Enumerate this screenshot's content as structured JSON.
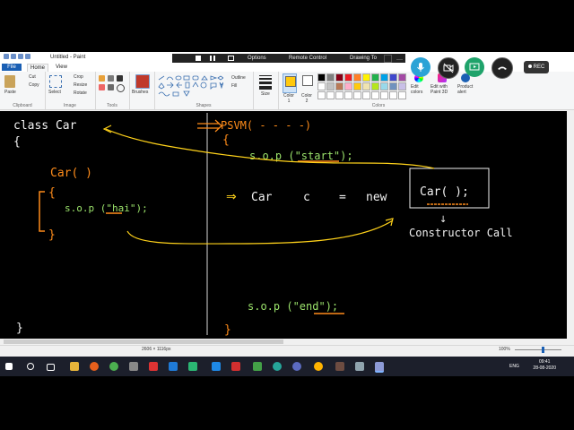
{
  "window": {
    "title": "Untitled - Paint"
  },
  "remote_bar": {
    "options": "Options",
    "remote_control": "Remote Control",
    "drawing_tools": "Drawing To"
  },
  "tabs": {
    "file": "File",
    "home": "Home",
    "view": "View"
  },
  "ribbon": {
    "clipboard": {
      "paste": "Paste",
      "cut": "Cut",
      "copy": "Copy",
      "group": "Clipboard"
    },
    "image": {
      "select": "Select",
      "crop": "Crop",
      "resize": "Resize",
      "rotate": "Rotate",
      "group": "Image"
    },
    "tools": {
      "group": "Tools"
    },
    "brushes": {
      "label": "Brushes"
    },
    "shapes": {
      "outline": "Outline",
      "fill": "Fill",
      "group": "Shapes"
    },
    "size": {
      "label": "Size"
    },
    "colors": {
      "color1": "Color 1",
      "color2": "Color 2",
      "edit_colors": "Edit colors",
      "edit_with_3d": "Edit with Paint 3D",
      "product_alert": "Product alert",
      "group": "Colors",
      "palette_row1": [
        "#000000",
        "#7f7f7f",
        "#880015",
        "#ed1c24",
        "#ff7f27",
        "#fff200",
        "#22b14c",
        "#00a2e8",
        "#3f48cc",
        "#a349a4"
      ],
      "palette_row2": [
        "#ffffff",
        "#c3c3c3",
        "#b97a57",
        "#ffaec9",
        "#ffc90e",
        "#efe4b0",
        "#b5e61d",
        "#99d9ea",
        "#7092be",
        "#c8bfe7"
      ],
      "color1_value": "#ffc90e",
      "color2_value": "#ffffff"
    }
  },
  "status": {
    "dimensions": "2606 × 1116px",
    "zoom": "100%"
  },
  "taskbar": {
    "time": "09:41",
    "date": "28-08-2020",
    "lang": "ENG"
  },
  "meeting": {
    "rec_label": "REC"
  },
  "canvas_text": {
    "class_decl": "class Car",
    "brace_open": "{",
    "psvm": "PSVM( - - - -)",
    "main_brace": "{",
    "sop_start": "s.o.p (\"start\");",
    "constructor": "Car( )",
    "ctor_brace_open": "{",
    "sop_hai": "s.o.p (\"hai\");",
    "ctor_brace_close": "}",
    "new_stmt_arrow": "⇒",
    "new_stmt_type": "Car",
    "new_stmt_var": "c",
    "new_stmt_eq": "=",
    "new_stmt_new": "new",
    "new_stmt_call": "Car( );",
    "down_arrow": "↓",
    "constructor_call": "Constructor Call",
    "sop_end": "s.o.p (\"end\");",
    "main_brace_close": "}",
    "class_brace_close": "}"
  },
  "colors": {
    "ink_white": "#f2f2f2",
    "ink_green": "#9be36b",
    "ink_orange": "#ff8c1a",
    "ink_yellow": "#ffd21a",
    "accent_blue": "#1a5fb4"
  }
}
